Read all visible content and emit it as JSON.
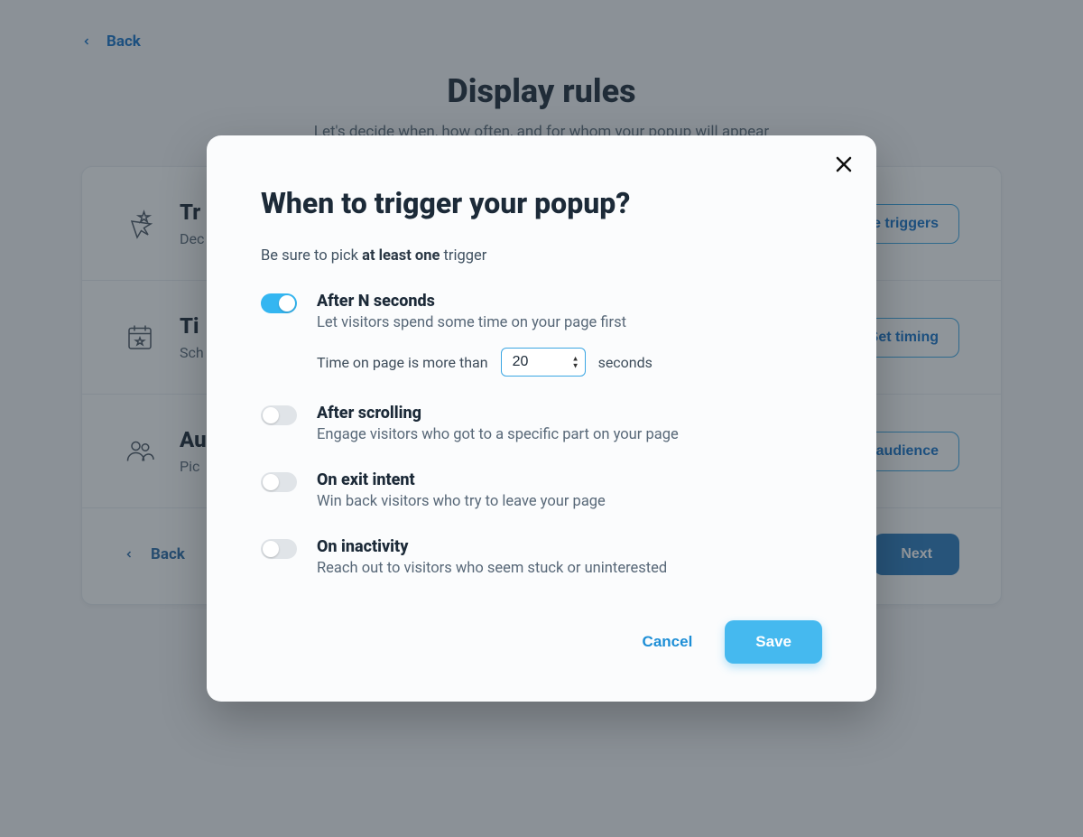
{
  "colors": {
    "accent": "#34b6f1",
    "link": "#1673c7",
    "primary_button": "#45b9ef",
    "next_button": "#2b7bbd"
  },
  "page": {
    "back_label": "Back",
    "title": "Display rules",
    "subtitle": "Let's decide when, how often, and for whom your popup will appear",
    "rows": [
      {
        "title_prefix": "Tr",
        "desc_prefix": "Dec",
        "action": "Choose triggers"
      },
      {
        "title_prefix": "Ti",
        "desc_prefix": "Sch",
        "action": "Set timing"
      },
      {
        "title_prefix": "Au",
        "desc_prefix": "Pic",
        "action": "Set audience"
      }
    ],
    "footer_back": "Back",
    "footer_next": "Next"
  },
  "modal": {
    "title": "When to trigger your popup?",
    "subtitle_pre": "Be sure to pick ",
    "subtitle_bold": "at least one",
    "subtitle_post": " trigger",
    "triggers": [
      {
        "key": "after-seconds",
        "enabled": true,
        "title": "After N seconds",
        "desc": "Let visitors spend some time on your page first",
        "config_pre": "Time on page is more than",
        "config_value": "20",
        "config_post": "seconds"
      },
      {
        "key": "after-scrolling",
        "enabled": false,
        "title": "After scrolling",
        "desc": "Engage visitors who got to a specific part on your page"
      },
      {
        "key": "exit-intent",
        "enabled": false,
        "title": "On exit intent",
        "desc": "Win back visitors who try to leave your page"
      },
      {
        "key": "inactivity",
        "enabled": false,
        "title": "On inactivity",
        "desc": "Reach out to visitors who seem stuck or uninterested"
      }
    ],
    "cancel": "Cancel",
    "save": "Save"
  }
}
